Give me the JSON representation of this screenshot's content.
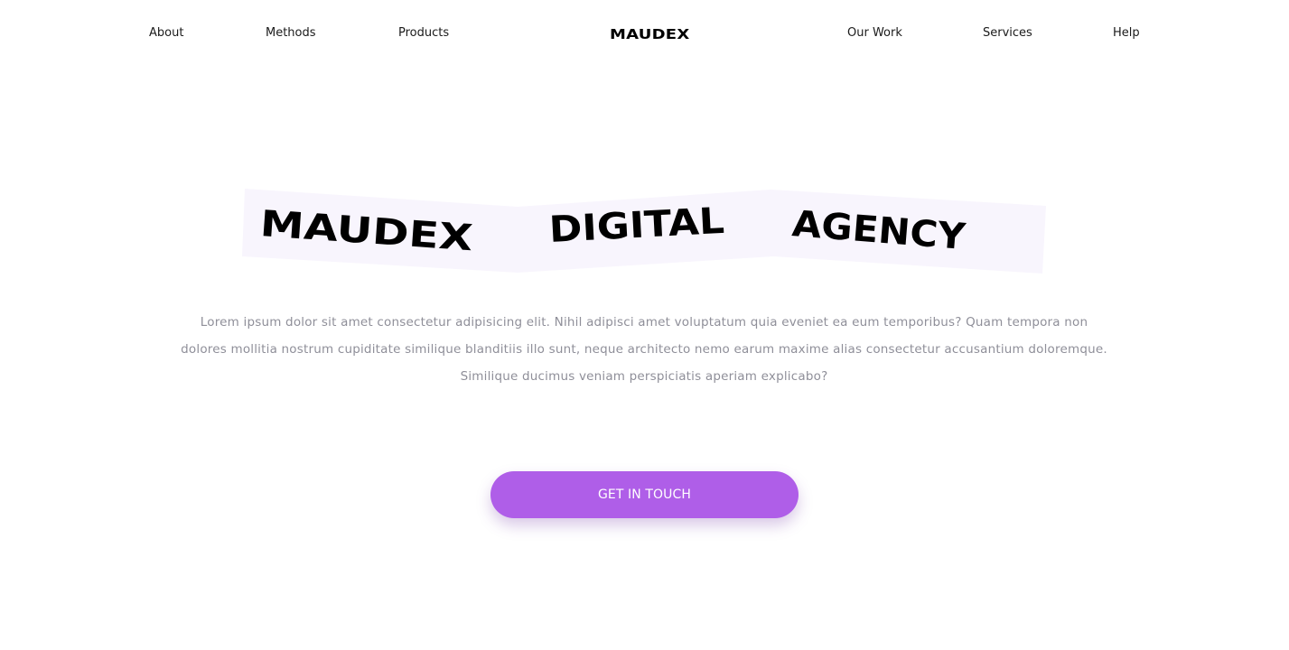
{
  "nav": {
    "left_items": [
      {
        "label": "About"
      },
      {
        "label": "Methods"
      },
      {
        "label": "Products"
      }
    ],
    "logo": "MAUDEX",
    "right_items": [
      {
        "label": "Our Work"
      },
      {
        "label": "Services"
      },
      {
        "label": "Help"
      }
    ]
  },
  "hero": {
    "words": [
      "MAUDEX",
      "DIGITAL",
      "AGENCY"
    ],
    "background_color": "#f8f5fd",
    "description": "Lorem ipsum dolor sit amet consectetur adipisicing elit. Nihil adipisci amet voluptatum quia eveniet ea eum temporibus? Quam tempora non dolores mollitia nostrum cupiditate similique blanditiis illo sunt, neque architecto nemo earum maxime alias consectetur accusantium doloremque. Similique ducimus veniam perspiciatis aperiam explicabo?",
    "cta_label": "GET IN TOUCH"
  },
  "colors": {
    "accent": "#af5ee8",
    "text_primary": "#1a1a1a",
    "text_muted": "#8f8f99",
    "background": "#ffffff"
  }
}
